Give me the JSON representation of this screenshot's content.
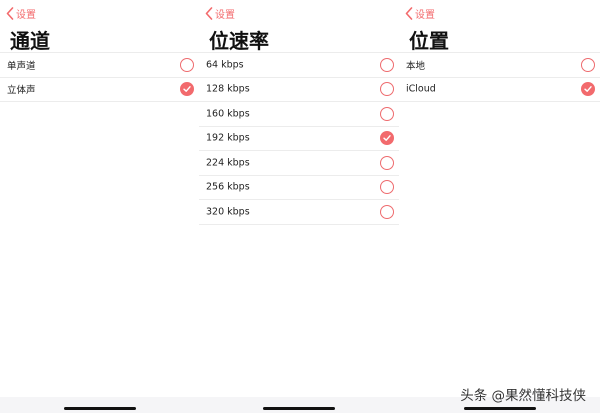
{
  "accent_color": "#f36a6c",
  "screens": [
    {
      "back_label": "设置",
      "title": "通道",
      "options": [
        {
          "label": "单声道",
          "selected": false
        },
        {
          "label": "立体声",
          "selected": true
        }
      ]
    },
    {
      "back_label": "设置",
      "title": "位速率",
      "options": [
        {
          "label": "64 kbps",
          "selected": false
        },
        {
          "label": "128 kbps",
          "selected": false
        },
        {
          "label": "160 kbps",
          "selected": false
        },
        {
          "label": "192 kbps",
          "selected": true
        },
        {
          "label": "224 kbps",
          "selected": false
        },
        {
          "label": "256 kbps",
          "selected": false
        },
        {
          "label": "320 kbps",
          "selected": false
        }
      ]
    },
    {
      "back_label": "设置",
      "title": "位置",
      "options": [
        {
          "label": "本地",
          "selected": false
        },
        {
          "label": "iCloud",
          "selected": true
        }
      ]
    }
  ],
  "watermark": "头条 @果然懂科技侠"
}
